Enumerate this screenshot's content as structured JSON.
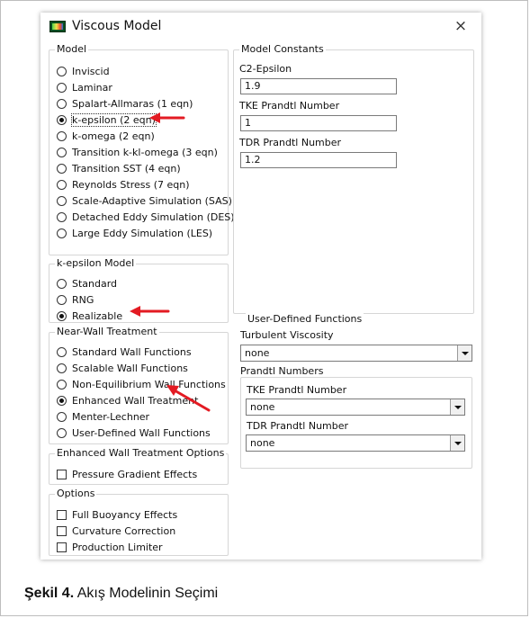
{
  "window": {
    "title": "Viscous Model",
    "close_symbol": "×",
    "icon": "fluent-app-icon"
  },
  "model": {
    "legend": "Model",
    "selected": "k-epsilon (2 eqn)",
    "options": [
      "Inviscid",
      "Laminar",
      "Spalart-Allmaras (1 eqn)",
      "k-epsilon (2 eqn)",
      "k-omega (2 eqn)",
      "Transition k-kl-omega (3 eqn)",
      "Transition SST (4 eqn)",
      "Reynolds Stress (7 eqn)",
      "Scale-Adaptive Simulation (SAS)",
      "Detached Eddy Simulation (DES)",
      "Large Eddy Simulation (LES)"
    ]
  },
  "kepsilon_model": {
    "legend": "k-epsilon Model",
    "selected": "Realizable",
    "options": [
      "Standard",
      "RNG",
      "Realizable"
    ]
  },
  "near_wall": {
    "legend": "Near-Wall Treatment",
    "selected": "Enhanced Wall Treatment",
    "options": [
      "Standard Wall Functions",
      "Scalable Wall Functions",
      "Non-Equilibrium Wall Functions",
      "Enhanced Wall Treatment",
      "Menter-Lechner",
      "User-Defined Wall Functions"
    ]
  },
  "ewt_options": {
    "legend": "Enhanced Wall Treatment Options",
    "pressure_gradient": "Pressure Gradient Effects",
    "pressure_gradient_checked": false
  },
  "options": {
    "legend": "Options",
    "items": [
      "Full Buoyancy Effects",
      "Curvature Correction",
      "Production Limiter"
    ],
    "checked": [
      false,
      false,
      false
    ]
  },
  "model_constants": {
    "legend": "Model Constants",
    "items": [
      {
        "label": "C2-Epsilon",
        "value": "1.9"
      },
      {
        "label": "TKE Prandtl Number",
        "value": "1"
      },
      {
        "label": "TDR Prandtl Number",
        "value": "1.2"
      }
    ]
  },
  "udf": {
    "legend": "User-Defined Functions",
    "turbulent_viscosity_label": "Turbulent Viscosity",
    "turbulent_viscosity_value": "none",
    "prandtl_legend": "Prandtl Numbers",
    "tke_label": "TKE Prandtl Number",
    "tke_value": "none",
    "tdr_label": "TDR Prandtl Number",
    "tdr_value": "none"
  },
  "annotations": {
    "arrow_color": "#e31b23"
  },
  "caption": {
    "bold": "Şekil 4.",
    "text": " Akış Modelinin Seçimi"
  }
}
